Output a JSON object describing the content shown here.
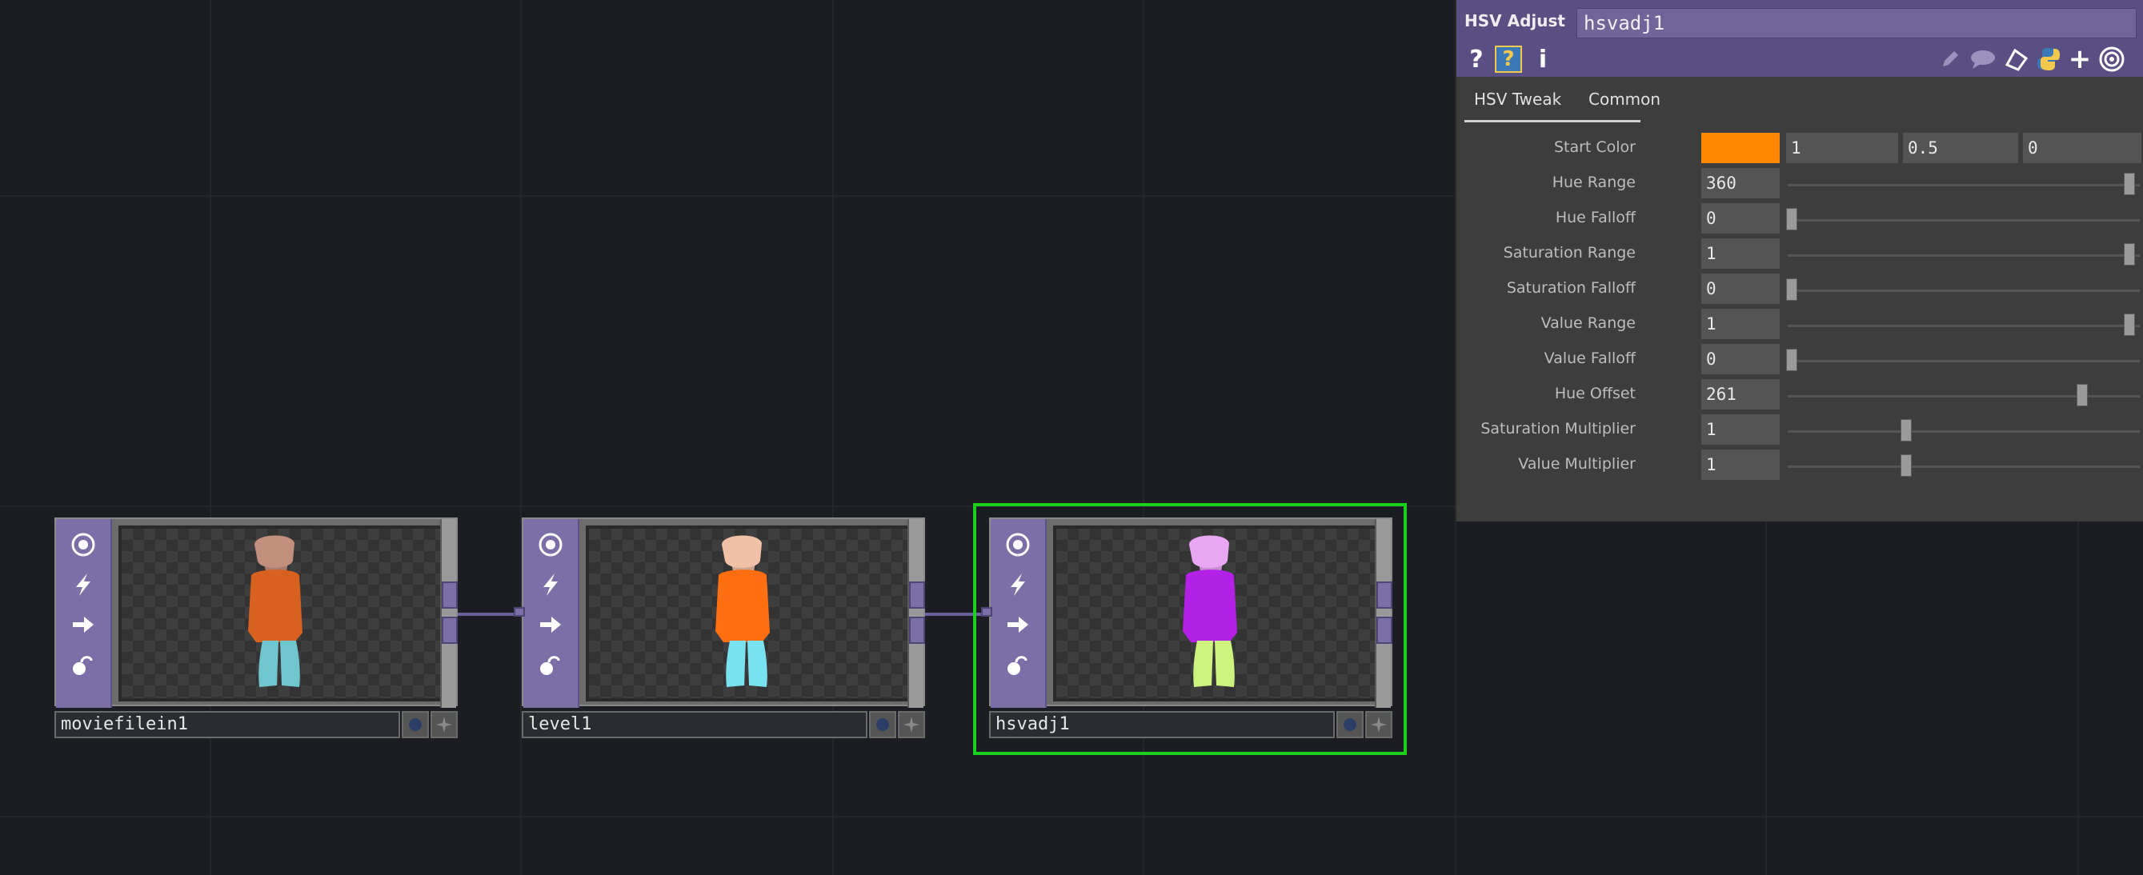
{
  "colors": {
    "background": "#1c1d22",
    "node_accent": "#7c6fa8",
    "selected_outline": "#19d11b",
    "panel_header": "#5a4f82",
    "start_color_swatch": "#ff8800"
  },
  "nodes": [
    {
      "name": "moviefilein1",
      "figure_colors": {
        "head": "#c28f7c",
        "shirt": "#d9611f",
        "legs": "#6fc6cf"
      }
    },
    {
      "name": "level1",
      "figure_colors": {
        "head": "#f0c1a6",
        "shirt": "#ff6f12",
        "legs": "#78e2f0"
      }
    },
    {
      "name": "hsvadj1",
      "figure_colors": {
        "head": "#e9a6f2",
        "shirt": "#b321e6",
        "legs": "#cdf27d"
      }
    }
  ],
  "node_icons": [
    "viewer-icon",
    "lightning-icon",
    "arrow-right-icon",
    "lock-icon"
  ],
  "footer_icons": [
    "display-toggle-icon",
    "plus-icon"
  ],
  "panel": {
    "title": "HSV Adjust",
    "op_name": "hsvadj1",
    "left_icons": [
      "question-icon",
      "python-help-icon",
      "info-icon"
    ],
    "right_icons": [
      "pencil-icon",
      "comment-icon",
      "bookmark-icon",
      "python-icon",
      "plus-icon",
      "target-icon"
    ],
    "left_icon_glyphs": [
      "?",
      "?",
      "i"
    ],
    "tabs": [
      "HSV Tweak",
      "Common"
    ],
    "active_tab": "HSV Tweak",
    "start_color": {
      "label": "Start Color",
      "values": [
        "1",
        "0.5",
        "0"
      ]
    },
    "params": [
      {
        "label": "Hue Range",
        "value": "360",
        "slider": 1.0
      },
      {
        "label": "Hue Falloff",
        "value": "0",
        "slider": 0.0
      },
      {
        "label": "Saturation Range",
        "value": "1",
        "slider": 1.0
      },
      {
        "label": "Saturation Falloff",
        "value": "0",
        "slider": 0.0
      },
      {
        "label": "Value Range",
        "value": "1",
        "slider": 1.0
      },
      {
        "label": "Value Falloff",
        "value": "0",
        "slider": 0.0
      },
      {
        "label": "Hue Offset",
        "value": "261",
        "slider": 0.86
      },
      {
        "label": "Saturation Multiplier",
        "value": "1",
        "slider": 0.34
      },
      {
        "label": "Value Multiplier",
        "value": "1",
        "slider": 0.34
      }
    ]
  }
}
